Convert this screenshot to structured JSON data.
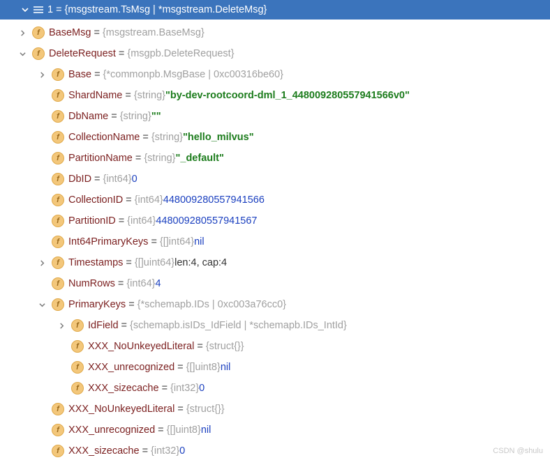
{
  "header": {
    "index": "1",
    "value": "{msgstream.TsMsg | *msgstream.DeleteMsg}"
  },
  "rows": [
    {
      "indent": 1,
      "toggle": "right",
      "name": "BaseMsg",
      "type": "{msgstream.BaseMsg}"
    },
    {
      "indent": 1,
      "toggle": "down",
      "name": "DeleteRequest",
      "type": "{msgpb.DeleteRequest}"
    },
    {
      "indent": 2,
      "toggle": "right",
      "name": "Base",
      "type": "{*commonpb.MsgBase | 0xc00316be60}"
    },
    {
      "indent": 2,
      "toggle": "none",
      "name": "ShardName",
      "type": "{string}",
      "str": "\"by-dev-rootcoord-dml_1_448009280557941566v0\""
    },
    {
      "indent": 2,
      "toggle": "none",
      "name": "DbName",
      "type": "{string}",
      "str": "\"\""
    },
    {
      "indent": 2,
      "toggle": "none",
      "name": "CollectionName",
      "type": "{string}",
      "str": "\"hello_milvus\""
    },
    {
      "indent": 2,
      "toggle": "none",
      "name": "PartitionName",
      "type": "{string}",
      "str": "\"_default\""
    },
    {
      "indent": 2,
      "toggle": "none",
      "name": "DbID",
      "type": "{int64}",
      "num": "0"
    },
    {
      "indent": 2,
      "toggle": "none",
      "name": "CollectionID",
      "type": "{int64}",
      "num": "448009280557941566"
    },
    {
      "indent": 2,
      "toggle": "none",
      "name": "PartitionID",
      "type": "{int64}",
      "num": "448009280557941567"
    },
    {
      "indent": 2,
      "toggle": "none",
      "name": "Int64PrimaryKeys",
      "type": "{[]int64}",
      "num": "nil"
    },
    {
      "indent": 2,
      "toggle": "right",
      "name": "Timestamps",
      "type": "{[]uint64}",
      "plain": "len:4, cap:4"
    },
    {
      "indent": 2,
      "toggle": "none",
      "name": "NumRows",
      "type": "{int64}",
      "num": "4"
    },
    {
      "indent": 2,
      "toggle": "down",
      "name": "PrimaryKeys",
      "type": "{*schemapb.IDs | 0xc003a76cc0}"
    },
    {
      "indent": 3,
      "toggle": "right",
      "name": "IdField",
      "type": "{schemapb.isIDs_IdField | *schemapb.IDs_IntId}"
    },
    {
      "indent": 3,
      "toggle": "none",
      "name": "XXX_NoUnkeyedLiteral",
      "type": "{struct{}}"
    },
    {
      "indent": 3,
      "toggle": "none",
      "name": "XXX_unrecognized",
      "type": "{[]uint8}",
      "num": "nil"
    },
    {
      "indent": 3,
      "toggle": "none",
      "name": "XXX_sizecache",
      "type": "{int32}",
      "num": "0"
    },
    {
      "indent": 2,
      "toggle": "none",
      "name": "XXX_NoUnkeyedLiteral",
      "type": "{struct{}}"
    },
    {
      "indent": 2,
      "toggle": "none",
      "name": "XXX_unrecognized",
      "type": "{[]uint8}",
      "num": "nil"
    },
    {
      "indent": 2,
      "toggle": "none",
      "name": "XXX_sizecache",
      "type": "{int32}",
      "num": "0"
    }
  ],
  "watermark": "CSDN @shulu"
}
